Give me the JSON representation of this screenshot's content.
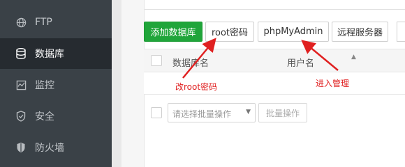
{
  "sidebar": {
    "items": [
      {
        "label": "FTP",
        "icon": "globe-icon",
        "active": false
      },
      {
        "label": "数据库",
        "icon": "database-icon",
        "active": true
      },
      {
        "label": "监控",
        "icon": "monitor-icon",
        "active": false
      },
      {
        "label": "安全",
        "icon": "shield-icon",
        "active": false
      },
      {
        "label": "防火墙",
        "icon": "firewall-icon",
        "active": false
      }
    ]
  },
  "toolbar": {
    "add_db_label": "添加数据库",
    "root_pwd_label": "root密码",
    "phpmyadmin_label": "phpMyAdmin",
    "remote_server_label": "远程服务器"
  },
  "table": {
    "columns": [
      "数据库名",
      "用户名"
    ]
  },
  "batch": {
    "select_placeholder": "请选择批量操作",
    "batch_button_label": "批量操作"
  },
  "annotations": {
    "root_note": "改root密码",
    "admin_note": "进入管理"
  },
  "colors": {
    "sidebar_bg": "#3a4147",
    "sidebar_active": "#262b30",
    "primary_green": "#20a53a",
    "annotation_red": "#e02020"
  }
}
